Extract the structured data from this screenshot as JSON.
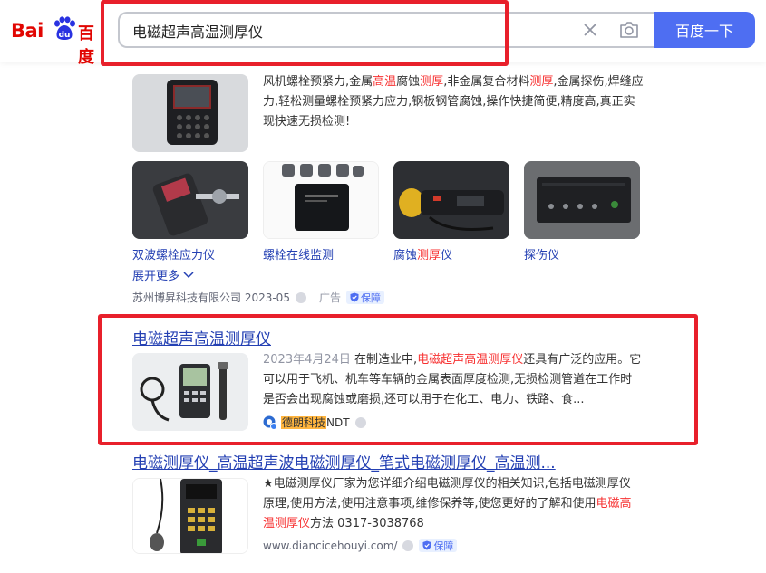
{
  "header": {
    "logo_text_left": "Bai",
    "logo_paw_text": "du",
    "logo_text_right": "百度",
    "search_value": "电磁超声高温测厚仪",
    "search_button": "百度一下",
    "clear_icon": "close-icon",
    "camera_icon": "camera-icon"
  },
  "ad": {
    "description_parts": [
      "风机螺栓预紧力,金属",
      "高温",
      "腐蚀",
      "测厚",
      ",非金属复合材料",
      "测厚",
      ",金属探伤,焊缝应力,轻松测量螺栓预紧力应力,钢板钢管腐蚀,操作快捷简便,精度高,真正实现快速无损检测!"
    ],
    "products": [
      {
        "label": "双波螺栓应力仪"
      },
      {
        "label": "螺栓在线监测"
      },
      {
        "label_parts": [
          "腐蚀",
          "测厚",
          "仪"
        ]
      },
      {
        "label": "探伤仪"
      }
    ],
    "expand_more": "展开更多",
    "company": "苏州博昇科技有限公司 2023-05",
    "ad_label": "广告",
    "guarantee_badge": "保障"
  },
  "result1": {
    "title": "电磁超声高温测厚仪",
    "date": "2023年4月24日",
    "snippet_parts": [
      "在制造业中,",
      "电磁超声高温测厚仪",
      "还具有广泛的应用。它可以用于飞机、机车等车辆的金属表面厚度检测,无损检测管道在工作时是否会出现腐蚀或磨损,还可以用于在化工、电力、铁路、食..."
    ],
    "source_highlight": "德朗科技",
    "source_suffix": "NDT"
  },
  "result2": {
    "title": "电磁测厚仪_高温超声波电磁测厚仪_笔式电磁测厚仪_高温测...",
    "snippet_parts": [
      "★电磁测厚仪厂家为您详细介绍电磁测厚仪的相关知识,包括电磁测厚仪原理,使用方法,使用注意事项,维修保养等,使您更好的了解和使用",
      "电磁高温测厚仪",
      "方法 0317-3038768"
    ],
    "url": "www.diancicehouyi.com/",
    "guarantee_badge": "保障"
  },
  "colors": {
    "brand_red": "#e10602",
    "link_blue": "#2440b3",
    "highlight_red": "#f73131",
    "button_blue": "#4e6ef2",
    "annotation_red": "#e8202b"
  }
}
